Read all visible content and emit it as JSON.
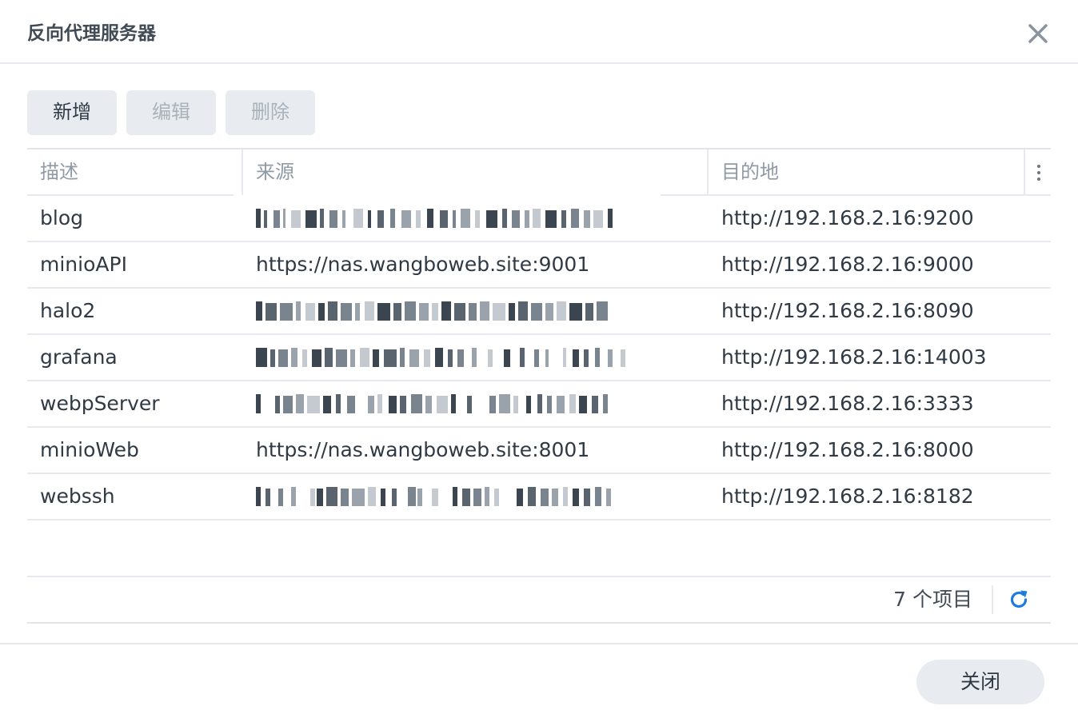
{
  "dialog": {
    "title": "反向代理服务器",
    "close_icon": "close-icon"
  },
  "toolbar": {
    "add_label": "新增",
    "edit_label": "编辑",
    "delete_label": "删除"
  },
  "table": {
    "columns": [
      "描述",
      "来源",
      "目的地"
    ],
    "menu_icon": "vertical-ellipsis-icon",
    "rows": [
      {
        "description": "blog",
        "source": "",
        "destination": "http://192.168.2.16:9200",
        "source_blurred": true
      },
      {
        "description": "minioAPI",
        "source": "https://nas.wangboweb.site:9001",
        "destination": "http://192.168.2.16:9000",
        "source_blurred": false
      },
      {
        "description": "halo2",
        "source": "",
        "destination": "http://192.168.2.16:8090",
        "source_blurred": true
      },
      {
        "description": "grafana",
        "source": "",
        "destination": "http://192.168.2.16:14003",
        "source_blurred": true
      },
      {
        "description": "webpServer",
        "source": "",
        "destination": "http://192.168.2.16:3333",
        "source_blurred": true
      },
      {
        "description": "minioWeb",
        "source": "https://nas.wangboweb.site:8001",
        "destination": "http://192.168.2.16:8000",
        "source_blurred": false
      },
      {
        "description": "webssh",
        "source": "",
        "destination": "http://192.168.2.16:8182",
        "source_blurred": true
      }
    ]
  },
  "footer": {
    "count_label": "7 个项目",
    "refresh_icon": "refresh-icon"
  },
  "actions": {
    "close_label": "关闭"
  },
  "colors": {
    "accent": "#1f7ae0",
    "button_bg": "#e8ecf0",
    "text": "#303a45",
    "muted": "#8f9aa5"
  }
}
